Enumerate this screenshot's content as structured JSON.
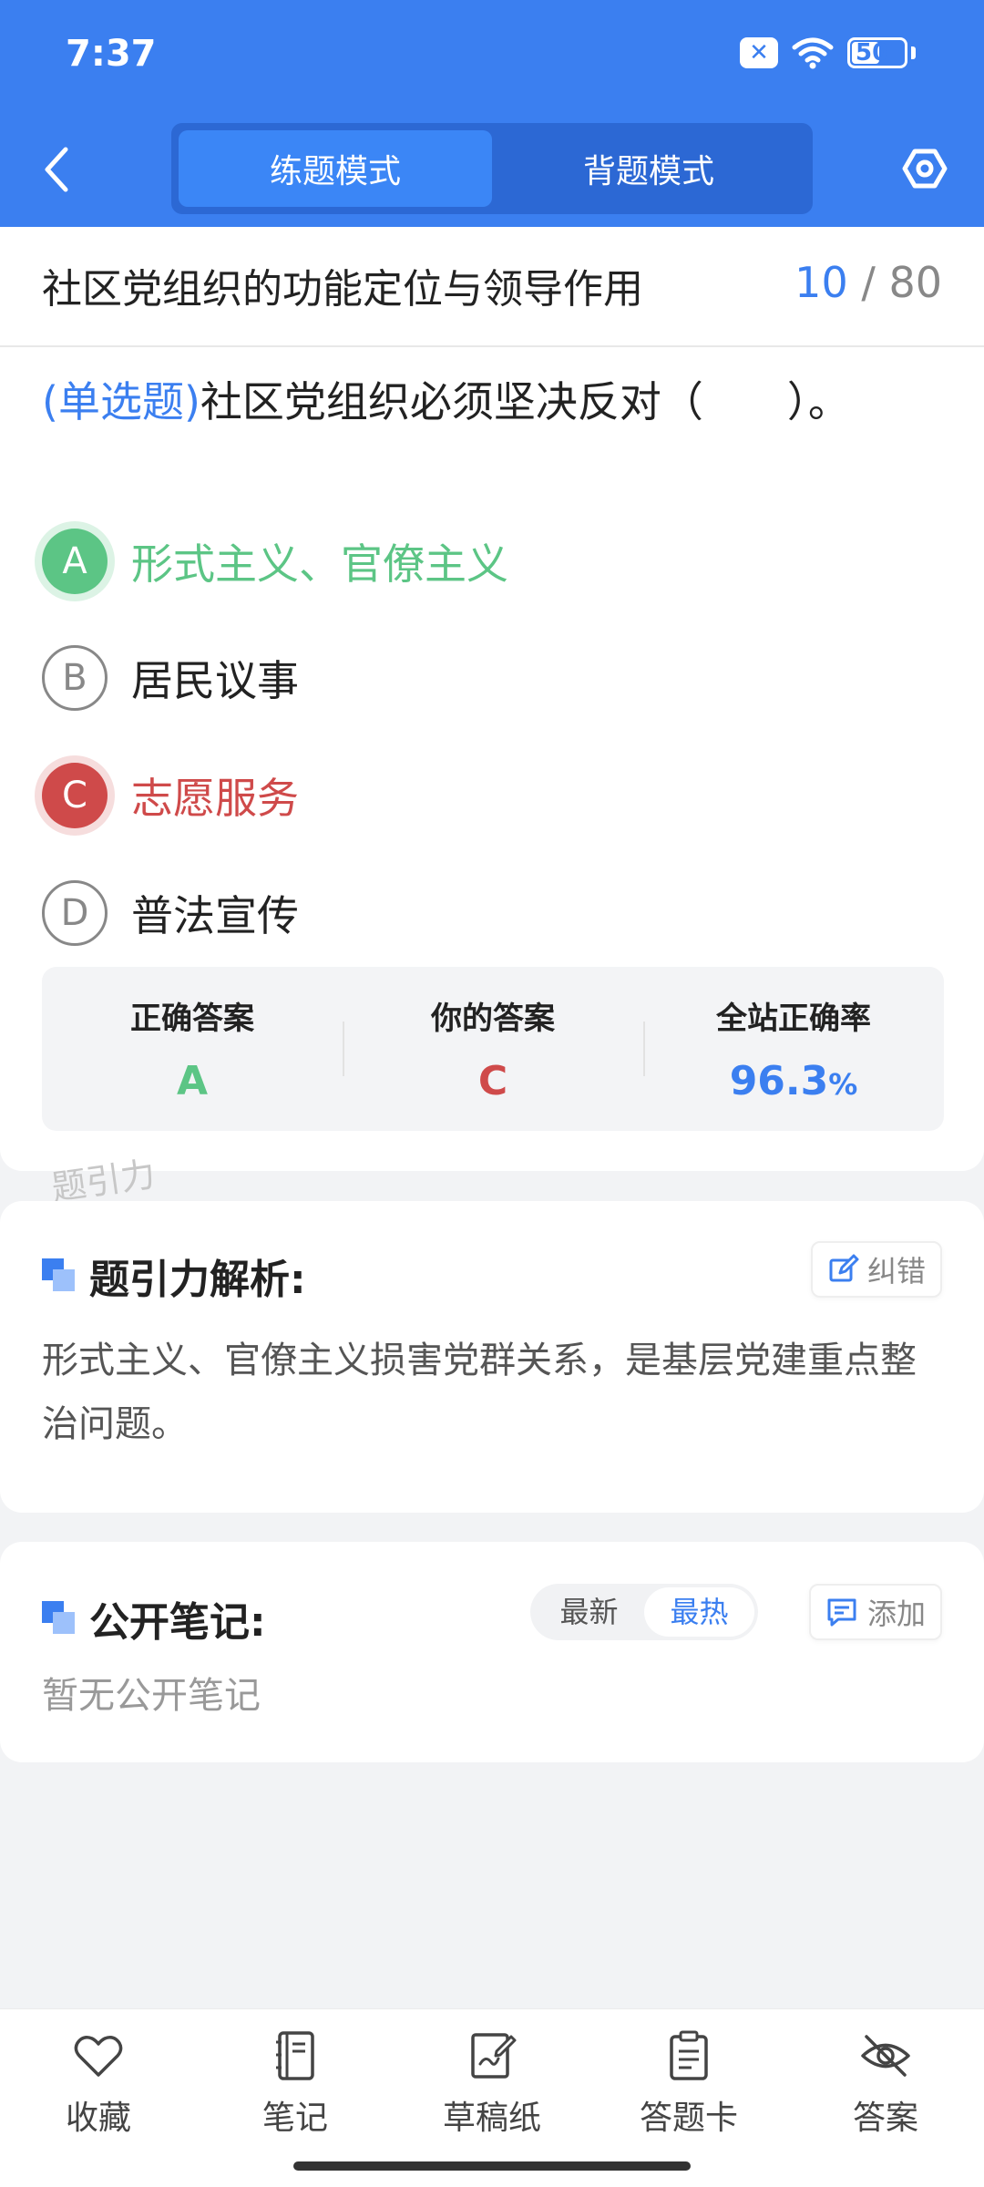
{
  "status": {
    "time": "7:37",
    "battery": "50"
  },
  "header": {
    "tabs": [
      {
        "label": "练题模式",
        "active": true
      },
      {
        "label": "背题模式",
        "active": false
      }
    ]
  },
  "section": {
    "title": "社区党组织的功能定位与领导作用",
    "current": "10",
    "total": "/ 80"
  },
  "question": {
    "type": "(单选题)",
    "text": "社区党组织必须坚决反对（　　）。",
    "options": [
      {
        "letter": "A",
        "text": "形式主义、官僚主义",
        "state": "correct"
      },
      {
        "letter": "B",
        "text": "居民议事",
        "state": "normal"
      },
      {
        "letter": "C",
        "text": "志愿服务",
        "state": "wrong"
      },
      {
        "letter": "D",
        "text": "普法宣传",
        "state": "normal"
      }
    ]
  },
  "stats": {
    "correct_label": "正确答案",
    "correct_value": "A",
    "yours_label": "你的答案",
    "yours_value": "C",
    "rate_label": "全站正确率",
    "rate_value": "96.3",
    "rate_unit": "%"
  },
  "watermark": "题引力",
  "analysis": {
    "title": "题引力解析:",
    "correct_btn": "纠错",
    "text": "形式主义、官僚主义损害党群关系，是基层党建重点整治问题。"
  },
  "notes": {
    "title": "公开笔记:",
    "sort": [
      "最新",
      "最热"
    ],
    "sort_active": "最热",
    "add_btn": "添加",
    "empty": "暂无公开笔记"
  },
  "bottom_nav": [
    {
      "label": "收藏",
      "icon": "heart-icon"
    },
    {
      "label": "笔记",
      "icon": "notebook-icon"
    },
    {
      "label": "草稿纸",
      "icon": "draft-icon"
    },
    {
      "label": "答题卡",
      "icon": "answer-card-icon"
    },
    {
      "label": "答案",
      "icon": "eye-off-icon"
    }
  ],
  "colors": {
    "primary": "#3b7ff0",
    "correct": "#5cc585",
    "wrong": "#cf4a4a"
  }
}
